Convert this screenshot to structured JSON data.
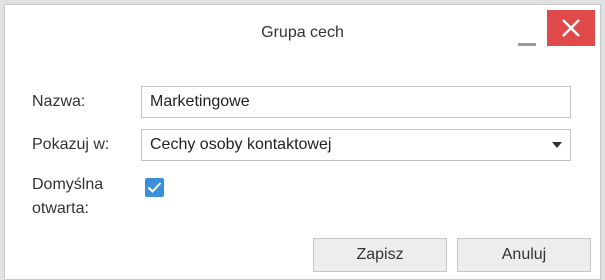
{
  "dialog": {
    "title": "Grupa cech"
  },
  "form": {
    "name_label": "Nazwa:",
    "name_value": "Marketingowe",
    "show_in_label": "Pokazuj w:",
    "show_in_value": "Cechy osoby kontaktowej",
    "default_open_label_line1": "Domyślna",
    "default_open_label_line2": "otwarta:",
    "default_open_checked": true
  },
  "buttons": {
    "save_label": "Zapisz",
    "cancel_label": "Anuluj"
  },
  "colors": {
    "close_button": "#e14a4b",
    "checkbox": "#3a8fd9",
    "button_bg": "#ededed"
  },
  "icons": {
    "minimize": "minimize-icon",
    "close": "close-icon",
    "dropdown": "chevron-down-icon",
    "checkmark": "checkmark-icon"
  }
}
